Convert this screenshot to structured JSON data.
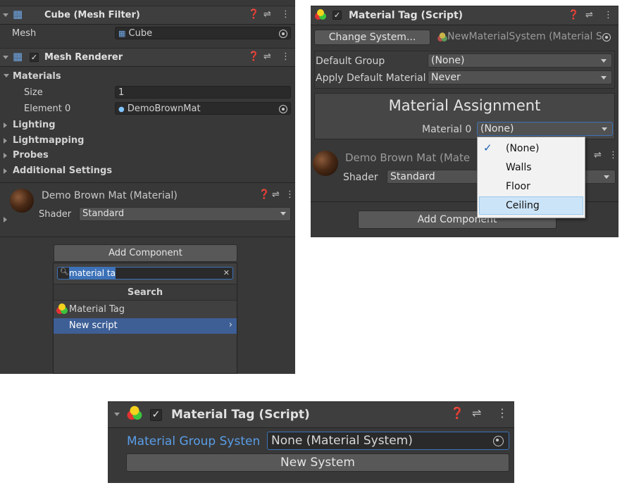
{
  "panel1": {
    "mesh_filter": {
      "title": "Cube (Mesh Filter)",
      "mesh_label": "Mesh",
      "mesh_value": "Cube"
    },
    "mesh_renderer": {
      "title": "Mesh Renderer",
      "materials_label": "Materials",
      "size_label": "Size",
      "size_value": "1",
      "element0_label": "Element 0",
      "element0_value": "DemoBrownMat",
      "foldouts": [
        "Lighting",
        "Lightmapping",
        "Probes",
        "Additional Settings"
      ]
    },
    "material": {
      "title": "Demo Brown Mat (Material)",
      "shader_label": "Shader",
      "shader_value": "Standard"
    },
    "add_component": {
      "button_label": "Add Component",
      "search_value": "material ta",
      "search_header": "Search",
      "results": [
        "Material Tag",
        "New script"
      ]
    }
  },
  "panel2": {
    "title": "Material Tag (Script)",
    "change_system_label": "Change System...",
    "system_value": "NewMaterialSystem (Material S",
    "default_group_label": "Default Group",
    "default_group_value": "(None)",
    "apply_default_label": "Apply Default Material",
    "apply_default_value": "Never",
    "assignment_title": "Material Assignment",
    "material0_label": "Material 0",
    "material0_value": "(None)",
    "dropdown_options": [
      "(None)",
      "Walls",
      "Floor",
      "Ceiling"
    ],
    "bg_material_title": "Demo Brown Mat (Mate",
    "bg_shader_label": "Shader",
    "bg_shader_value": "Standard",
    "add_component_label": "Add Component"
  },
  "panel3": {
    "title": "Material Tag (Script)",
    "group_system_label": "Material Group Systen",
    "group_system_value": "None (Material System)",
    "new_system_label": "New System"
  },
  "colors": {
    "accent_blue": "#3d72b8",
    "label_blue": "#5a9ee8",
    "highlight": "#cce4f7"
  }
}
